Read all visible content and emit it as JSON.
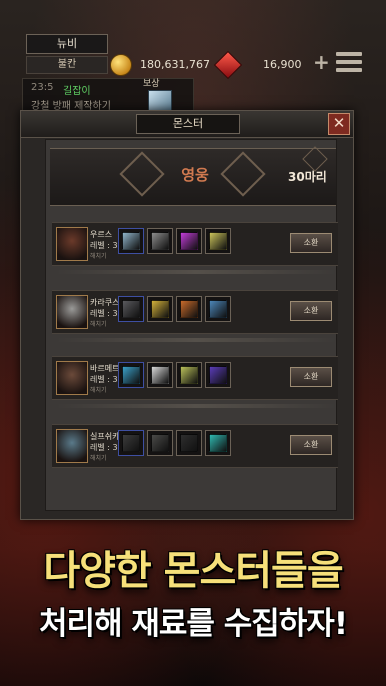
{
  "header": {
    "player_name": "뉴비",
    "region": "불칸",
    "gold": "180,631,767",
    "gems": "16,900",
    "icons": {
      "gold": "gold-coin-icon",
      "gem": "ruby-gem-icon",
      "add": "plus-icon",
      "menu": "menu-icon"
    }
  },
  "quest": {
    "timer": "23:5",
    "tag": "길잡이",
    "title": "강철 방패 제작하기",
    "reward_label": "보상"
  },
  "panel": {
    "title": "몬스터",
    "close_label": "✕",
    "category": "영웅",
    "count": "30마리"
  },
  "monsters": [
    {
      "name": "우르스",
      "level": "레벨 : 3",
      "note": "해치기",
      "summon": "소환",
      "portrait_color": "#6b3a2a",
      "items": [
        "#8fb3c8",
        "#8c8c8c",
        "#c23cd8",
        "#c9c25a"
      ]
    },
    {
      "name": "카라쿠스",
      "level": "레벨 : 3",
      "note": "해치기",
      "summon": "소환",
      "portrait_color": "#9a9a98",
      "items": [
        "#5a5a5e",
        "#d2b13a",
        "#c86a2a",
        "#4c86b8"
      ]
    },
    {
      "name": "바르메트",
      "level": "레벨 : 3",
      "note": "해치기",
      "summon": "소환",
      "portrait_color": "#6b4a3a",
      "items": [
        "#3aa0c8",
        "#d8d8d8",
        "#b9c05a",
        "#5a3cb8"
      ]
    },
    {
      "name": "실프쉬카",
      "level": "레벨 : 3",
      "note": "해치기",
      "summon": "소환",
      "portrait_color": "#5a7a8a",
      "items": [
        "#3b3b3b",
        "#4a4a48",
        "#2e2e2e",
        "#2fb8b0"
      ]
    }
  ],
  "promo": {
    "line1": "다양한 몬스터들을",
    "line2": "처리해 재료를 수집하자!"
  },
  "colors": {
    "accent_gold": "#f6e07a",
    "category_text": "#d17a50",
    "quest_tag": "#5fcf63"
  }
}
